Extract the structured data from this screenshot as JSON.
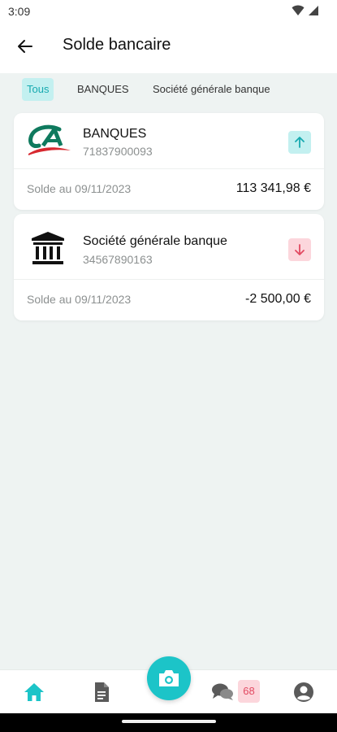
{
  "status_bar": {
    "time": "3:09",
    "icons": [
      "wifi-icon",
      "cell-signal-icon"
    ]
  },
  "header": {
    "title": "Solde bancaire",
    "back_icon": "arrow-back-icon"
  },
  "filters": [
    {
      "label": "Tous",
      "active": true
    },
    {
      "label": "BANQUES",
      "active": false
    },
    {
      "label": "Société générale banque",
      "active": false
    }
  ],
  "accounts": [
    {
      "name": "BANQUES",
      "number": "71837900093",
      "logo": "credit-agricole-logo",
      "trend": "up",
      "balance_label": "Solde au 09/11/2023",
      "balance": "113 341,98 €"
    },
    {
      "name": "Société générale banque",
      "number": "34567890163",
      "logo": "bank-building-icon",
      "trend": "down",
      "balance_label": "Solde au 09/11/2023",
      "balance": "-2 500,00 €"
    }
  ],
  "bottom_nav": {
    "items": [
      "home-icon",
      "document-icon",
      "camera-icon",
      "chat-icon",
      "profile-icon"
    ],
    "active": "home-icon",
    "chat_badge": "68"
  },
  "colors": {
    "accent": "#1cc4c8",
    "accent_light": "#c3f0f0",
    "negative": "#e24a62",
    "negative_light": "#fcd6dc",
    "background": "#eef3f2",
    "logo_green": "#0f7a5e",
    "logo_red": "#d7282f"
  }
}
